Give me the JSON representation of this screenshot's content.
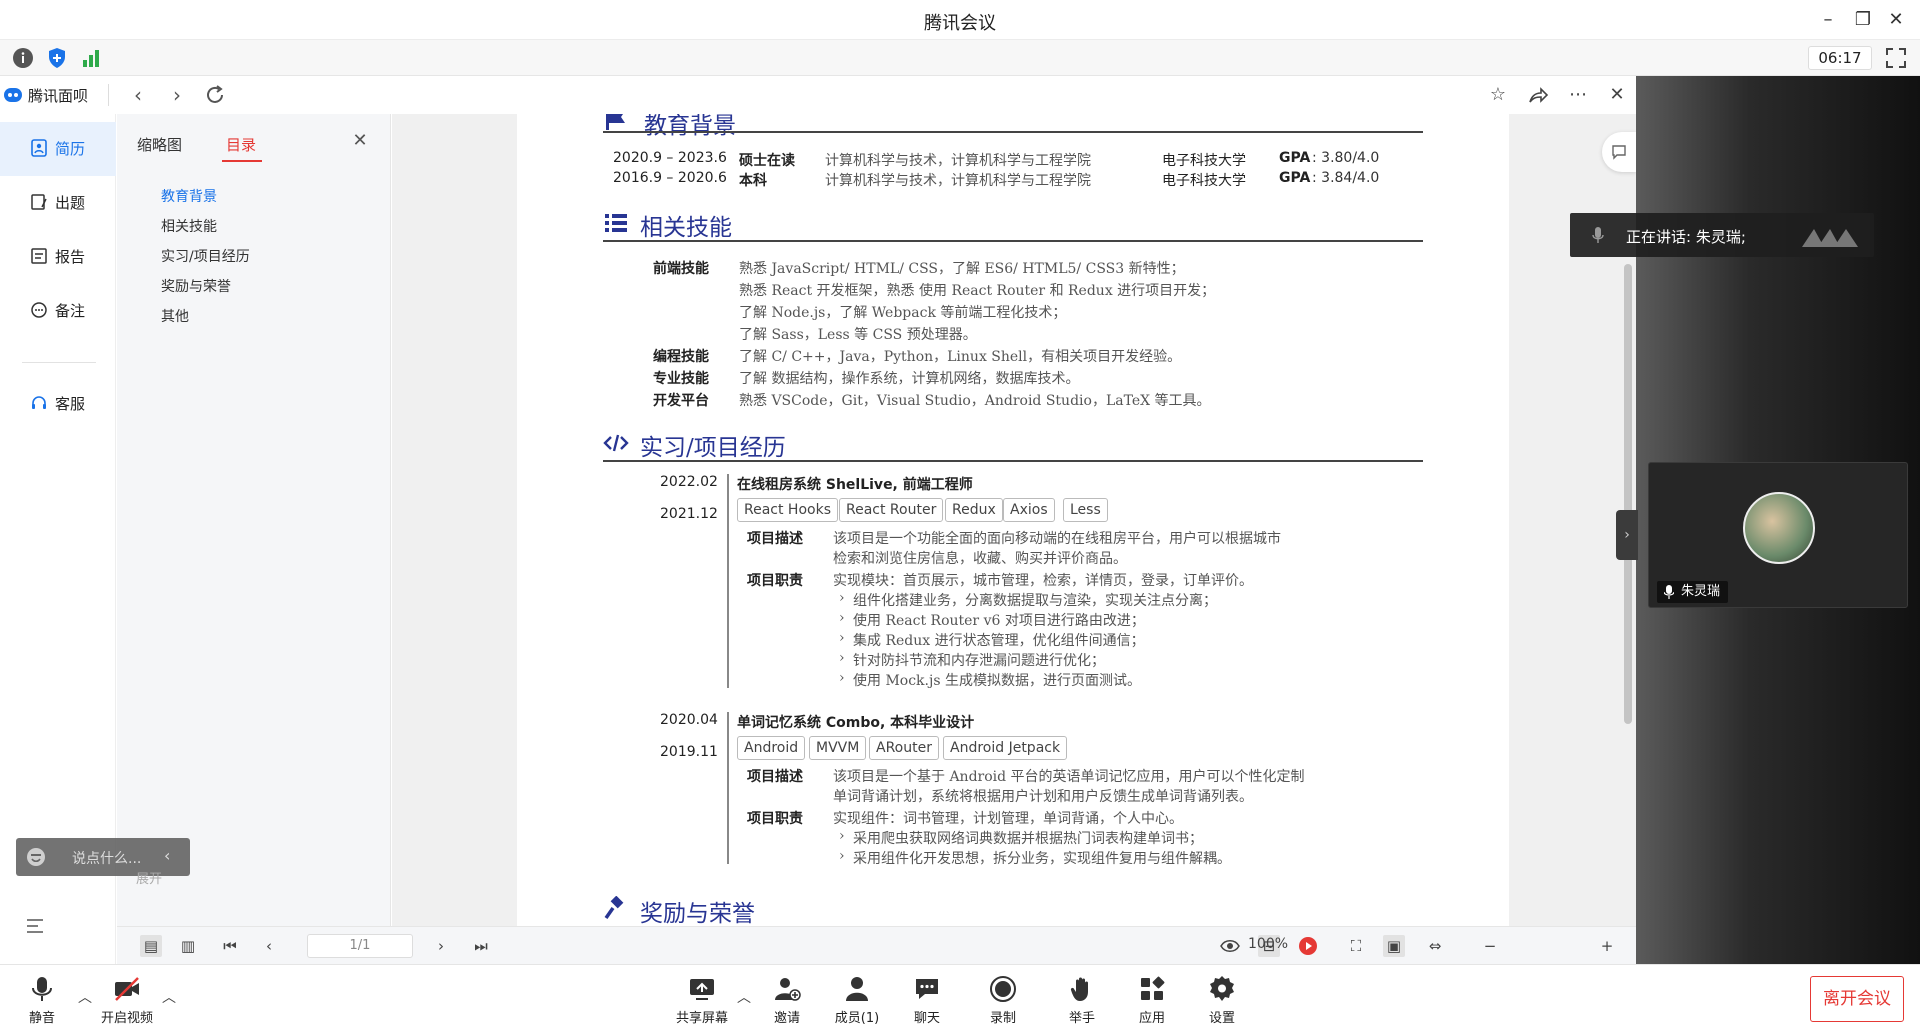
{
  "window": {
    "title": "腾讯会议"
  },
  "status": {
    "timer": "06:17"
  },
  "app": {
    "title": "腾讯面呗",
    "sidebar": [
      {
        "label": "简历",
        "icon": "resume-icon",
        "active": true
      },
      {
        "label": "出题",
        "icon": "question-icon"
      },
      {
        "label": "报告",
        "icon": "report-icon"
      },
      {
        "label": "备注",
        "icon": "note-icon"
      },
      {
        "label": "客服",
        "icon": "headset-icon"
      }
    ],
    "toc": {
      "tabs": [
        {
          "label": "缩略图"
        },
        {
          "label": "目录",
          "active": true
        }
      ],
      "items": [
        "教育背景",
        "相关技能",
        "实习/项目经历",
        "奖励与荣誉",
        "其他"
      ]
    }
  },
  "resume": {
    "education": {
      "title": "教育背景",
      "rows": [
        {
          "date": "2020.9 – 2023.6",
          "degree": "硕士在读",
          "major": "计算机科学与技术，计算机科学与工程学院",
          "school": "电子科技大学",
          "gpa_label": "GPA",
          "gpa": ": 3.80/4.0"
        },
        {
          "date": "2016.9 – 2020.6",
          "degree": "本科",
          "major": "计算机科学与技术，计算机科学与工程学院",
          "school": "电子科技大学",
          "gpa_label": "GPA",
          "gpa": ": 3.84/4.0"
        }
      ]
    },
    "skills": {
      "title": "相关技能",
      "items": [
        {
          "label": "前端技能",
          "lines": [
            "熟悉 JavaScript/ HTML/ CSS，了解 ES6/ HTML5/ CSS3 新特性；",
            "熟悉 React 开发框架，熟悉 使用 React Router 和 Redux 进行项目开发；",
            "了解 Node.js，了解 Webpack 等前端工程化技术；",
            "了解 Sass，Less 等 CSS 预处理器。"
          ]
        },
        {
          "label": "编程技能",
          "lines": [
            "了解 C/ C++，Java，Python，Linux Shell，有相关项目开发经验。"
          ]
        },
        {
          "label": "专业技能",
          "lines": [
            "了解 数据结构，操作系统，计算机网络，数据库技术。"
          ]
        },
        {
          "label": "开发平台",
          "lines": [
            "熟悉 VSCode，Git，Visual Studio，Android Studio，LaTeX 等工具。"
          ]
        }
      ]
    },
    "projects": {
      "title": "实习/项目经历",
      "items": [
        {
          "end": "2022.02",
          "start": "2021.12",
          "title": "在线租房系统 ShelLive, 前端工程师",
          "tags": [
            "React Hooks",
            "React Router",
            "Redux",
            "Axios",
            "Less"
          ],
          "desc_label": "项目描述",
          "desc": [
            "该项目是一个功能全面的面向移动端的在线租房平台，用户可以根据城市",
            "检索和浏览住房信息，收藏、购买并评价商品。"
          ],
          "duty_label": "项目职责",
          "duty_head": "实现模块：首页展示，城市管理，检索，详情页，登录，订单评价。",
          "duties": [
            "组件化搭建业务，分离数据提取与渲染，实现关注点分离；",
            "使用 React Router v6 对项目进行路由改进；",
            "集成 Redux 进行状态管理，优化组件间通信；",
            "针对防抖节流和内存泄漏问题进行优化；",
            "使用 Mock.js 生成模拟数据，进行页面测试。"
          ]
        },
        {
          "end": "2020.04",
          "start": "2019.11",
          "title": "单词记忆系统 Combo, 本科毕业设计",
          "tags": [
            "Android",
            "MVVM",
            "ARouter",
            "Android Jetpack"
          ],
          "desc_label": "项目描述",
          "desc": [
            "该项目是一个基于 Android 平台的英语单词记忆应用，用户可以个性化定制",
            "单词背诵计划，系统将根据用户计划和用户反馈生成单词背诵列表。"
          ],
          "duty_label": "项目职责",
          "duty_head": "实现组件：词书管理，计划管理，单词背诵，个人中心。",
          "duties": [
            "采用爬虫获取网络词典数据并根据热门词表构建单词书；",
            "采用组件化开发思想，拆分业务，实现组件复用与组件解耦。"
          ]
        }
      ]
    },
    "awards": {
      "title": "奖励与荣誉"
    }
  },
  "viewer": {
    "page": "1/1",
    "zoom": "100%"
  },
  "meeting": {
    "speaking": "正在讲话: 朱灵瑞;",
    "participant": "朱灵瑞",
    "chat_placeholder": "说点什么...",
    "expand": "展开",
    "toolbar": [
      {
        "label": "静音",
        "icon": "microphone-icon"
      },
      {
        "label": "开启视频",
        "icon": "camera-off-icon"
      },
      {
        "label": "共享屏幕",
        "icon": "share-screen-icon"
      },
      {
        "label": "邀请",
        "icon": "invite-icon"
      },
      {
        "label": "成员(1)",
        "icon": "members-icon"
      },
      {
        "label": "聊天",
        "icon": "chat-icon"
      },
      {
        "label": "录制",
        "icon": "record-icon"
      },
      {
        "label": "举手",
        "icon": "raise-hand-icon"
      },
      {
        "label": "应用",
        "icon": "apps-icon"
      },
      {
        "label": "设置",
        "icon": "settings-icon"
      }
    ],
    "leave": "离开会议"
  },
  "colors": {
    "accent": "#1a73e8",
    "danger": "#e53935",
    "heading": "#283593"
  }
}
